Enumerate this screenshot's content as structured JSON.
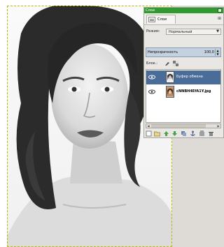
{
  "canvas": {
    "image_name": "portrait-photo"
  },
  "layers_dialog": {
    "title": "Слои",
    "tab_label": "Слои",
    "mode_label": "Режим:",
    "mode_value": "Нормальный",
    "opacity_label": "Непрозрачность",
    "opacity_value": "100,0",
    "lock_label": "Блок.:",
    "layers": [
      {
        "name": "Буфер обмена",
        "selected": true,
        "visible": true
      },
      {
        "name": "cNNBH4EfA1Y.jpg",
        "selected": false,
        "visible": true
      }
    ],
    "bottom_icons": [
      "new-layer-icon",
      "new-group-icon",
      "raise-layer-icon",
      "lower-layer-icon",
      "duplicate-layer-icon",
      "anchor-icon",
      "merge-icon",
      "delete-icon"
    ]
  },
  "colors": {
    "titlebar": "#2f9a2f",
    "selection": "#4a6c98",
    "marching_ants": "#b8b800"
  }
}
